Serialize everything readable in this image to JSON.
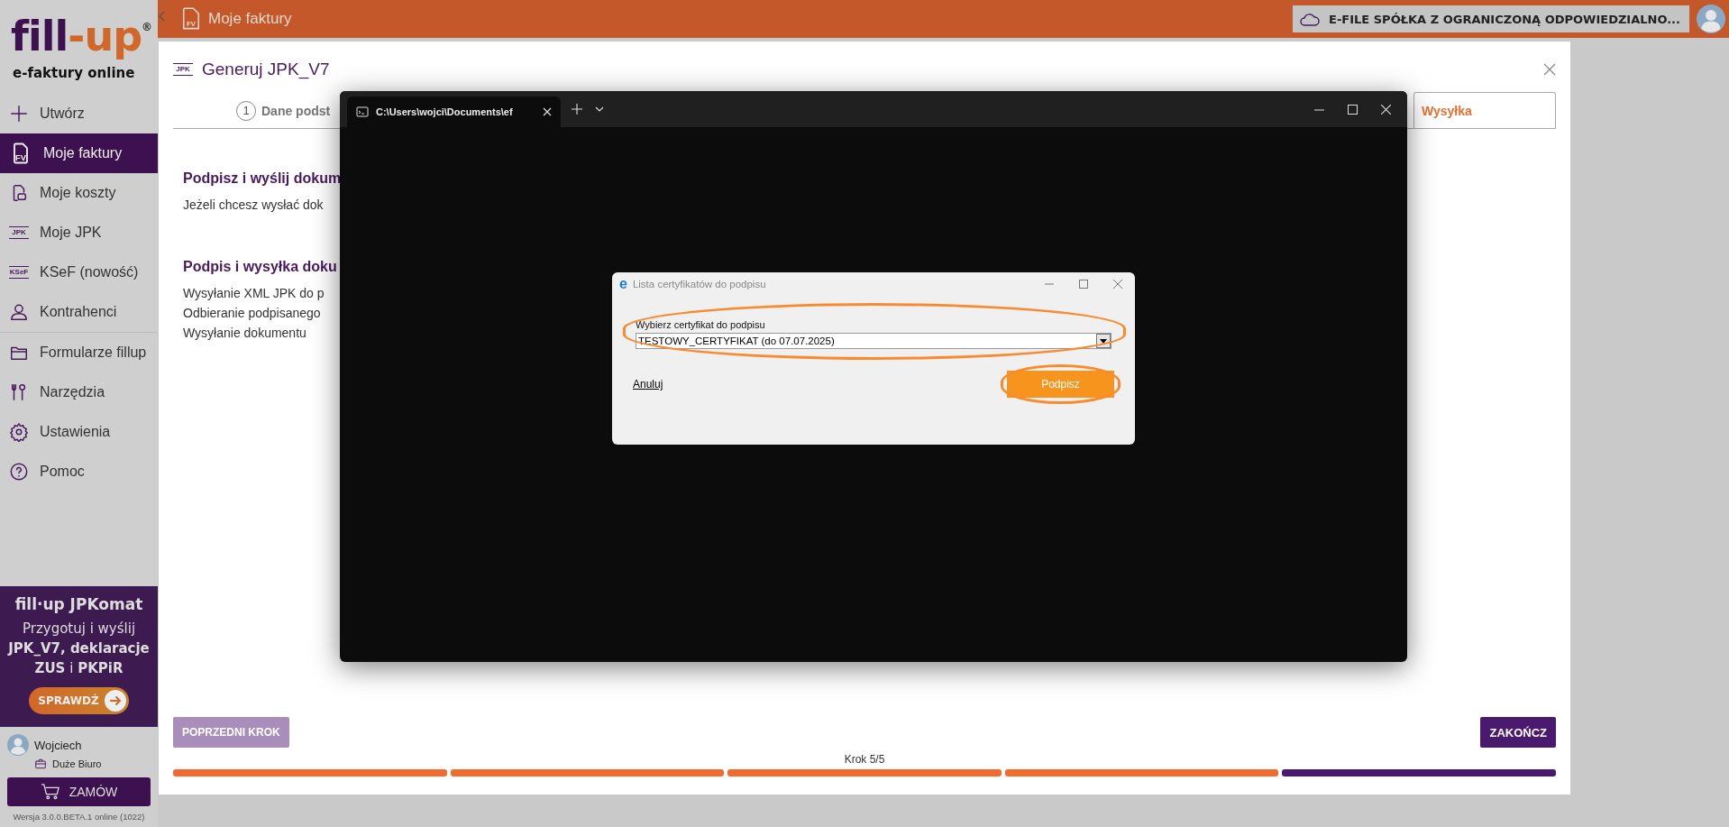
{
  "sidebar": {
    "logo": {
      "word": "fill",
      "suffix": "-up",
      "mark": "®"
    },
    "tagline": "e-faktury online",
    "groups": [
      {
        "items": [
          {
            "label": "Utwórz",
            "selected": false
          },
          {
            "label": "Moje faktury",
            "selected": true,
            "icon_label": "FV"
          },
          {
            "label": "Moje koszty",
            "selected": false
          },
          {
            "label": "Moje JPK",
            "selected": false,
            "icon_label": "JPK"
          },
          {
            "label": "KSeF (nowość)",
            "selected": false,
            "icon_label": "KSeF"
          },
          {
            "label": "Kontrahenci",
            "selected": false
          }
        ]
      },
      {
        "items": [
          {
            "label": "Formularze fillup",
            "selected": false
          },
          {
            "label": "Narzędzia",
            "selected": false
          },
          {
            "label": "Ustawienia",
            "selected": false
          },
          {
            "label": "Pomoc",
            "selected": false
          }
        ]
      }
    ],
    "promo": {
      "title": "fill·up JPKomat",
      "text": "Przygotuj i wyślij **JPK_V7, deklaracje** **ZUS** i **PKPiR**",
      "button": "SPRAWDŹ"
    },
    "user": {
      "name": "Wojciech",
      "plan": "Duże Biuro"
    },
    "order_button": "ZAMÓW",
    "version": "Wersja 3.0.0.BETA.1 online (1022)"
  },
  "top_bar": {
    "title": "Moje faktury",
    "title_icon_label": "FV",
    "company": "E-FILE SPÓŁKA Z OGRANICZONĄ ODPOWIEDZIALNO..."
  },
  "modal": {
    "icon_label": "JPK",
    "title": "Generuj JPK_V7",
    "tabs": [
      {
        "number": "1",
        "label": "Dane podst",
        "selected": false
      },
      {
        "label": "Wysyłka",
        "selected": true
      }
    ],
    "sections": [
      {
        "heading": "Podpisz i wyślij dokum",
        "lines": [
          "Jeżeli chcesz wysłać dok"
        ]
      },
      {
        "heading": "Podpis i wysyłka doku",
        "lines": [
          "Wysyłanie XML JPK do p",
          "Odbieranie podpisanego",
          "Wysyłanie dokumentu"
        ]
      }
    ],
    "back_button": "POPRZEDNI KROK",
    "finish_button": "ZAKOŃCZ",
    "step_text": "Krok 5/5",
    "steps": [
      {
        "done": true
      },
      {
        "done": true
      },
      {
        "done": true
      },
      {
        "done": true
      },
      {
        "done": false
      }
    ]
  },
  "terminal": {
    "tab_title": "C:\\Users\\wojci\\Documents\\ef",
    "dialog": {
      "logo": "e",
      "title": "Lista certyfikatów do podpisu",
      "field_label": "Wybierz certyfikat do podpisu",
      "certificate": "TESTOWY_CERTYFIKAT (do 07.07.2025)",
      "cancel": "Anuluj",
      "sign_button": "Podpisz"
    }
  }
}
